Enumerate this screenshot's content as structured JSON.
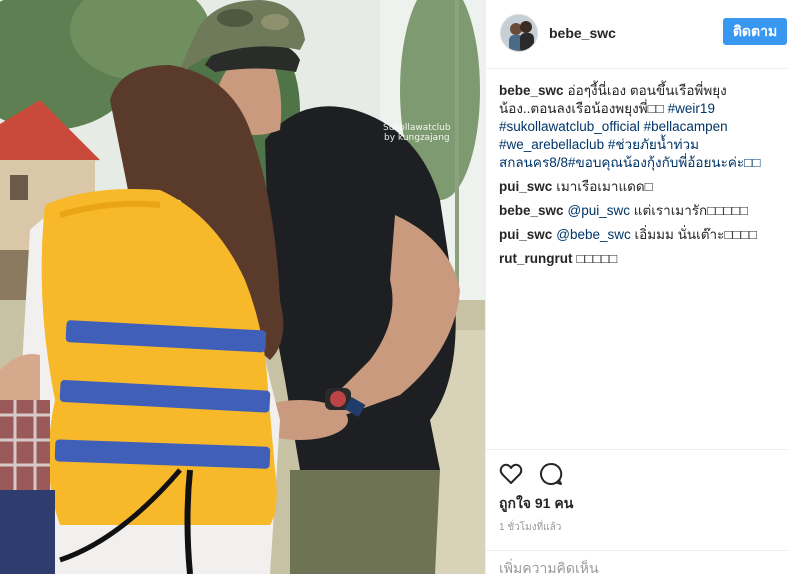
{
  "photo": {
    "watermark": [
      "Sukollawatclub",
      "by kungzajang"
    ]
  },
  "header": {
    "username": "bebe_swc",
    "follow_label": "ติดตาม"
  },
  "comments": [
    {
      "user": "bebe_swc",
      "parts": [
        {
          "t": "อ่อๆงี้นี่เอง ตอนขึ้นเรือพี่พยุงน้อง..ตอนลงเรือน้องพยุงพี่"
        },
        {
          "t": "□□ "
        },
        {
          "t": "#weir19",
          "tag": true
        },
        {
          "t": " "
        },
        {
          "t": "#sukollawatclub_official",
          "tag": true
        },
        {
          "t": " "
        },
        {
          "t": "#bellacampen",
          "tag": true
        },
        {
          "t": " "
        },
        {
          "t": "#we_arebellaclub",
          "tag": true
        },
        {
          "t": " "
        },
        {
          "t": "#ช่วยภัยน้ำท่วมสกลนคร8/8",
          "tag": true
        },
        {
          "t": "#ขอบคุณน้องกุ้งกับพี่อ้อยนะค่ะ□□",
          "tag": true
        }
      ]
    },
    {
      "user": "pui_swc",
      "parts": [
        {
          "t": "เมาเรือเมาแดด□"
        }
      ]
    },
    {
      "user": "bebe_swc",
      "parts": [
        {
          "t": "@pui_swc",
          "tag": true
        },
        {
          "t": " แต่เราเมารัก□□□□□"
        }
      ]
    },
    {
      "user": "pui_swc",
      "parts": [
        {
          "t": "@bebe_swc",
          "tag": true
        },
        {
          "t": " เอิ่มมม นั่นเต๊าะ□□□□"
        }
      ]
    },
    {
      "user": "rut_rungrut",
      "parts": [
        {
          "t": "□□□□□"
        }
      ]
    }
  ],
  "actions": {
    "like_icon": "heart-icon",
    "comment_icon": "comment-bubble-icon",
    "likes_text": "ถูกใจ 91 คน",
    "time_text": "1 ชั่วโมงที่แล้ว",
    "add_comment_placeholder": "เพิ่มความคิดเห็น"
  },
  "colors": {
    "accent": "#3897f0",
    "link": "#003569",
    "vest": "#f7b82a",
    "strap": "#3f5fb9"
  }
}
